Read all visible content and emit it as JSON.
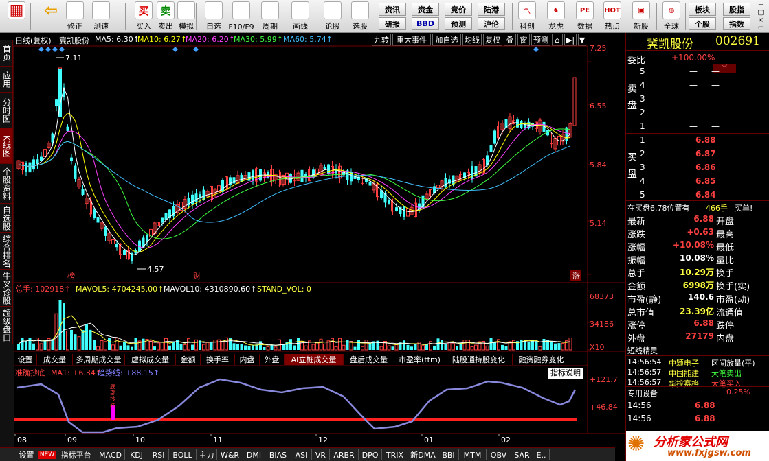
{
  "toolbar": {
    "left_items": [
      {
        "label": "",
        "icon": "grid-icon"
      },
      {
        "label": "",
        "icon": "back-arrow-icon"
      },
      {
        "label": "修正",
        "icon": "up-arrow-icon"
      },
      {
        "label": "测速",
        "icon": "clock-icon"
      },
      {
        "label": "买入",
        "icon": "buy-icon",
        "glyph": "买"
      },
      {
        "label": "卖出",
        "icon": "sell-icon",
        "glyph": "卖"
      },
      {
        "label": "模拟",
        "icon": "hammer-icon"
      },
      {
        "label": "自选",
        "icon": "star-icon"
      },
      {
        "label": "F10/F9",
        "icon": "f10-icon"
      },
      {
        "label": "周期",
        "icon": "period-icon"
      },
      {
        "label": "画线",
        "icon": "pencil-icon"
      },
      {
        "label": "论股",
        "icon": "discuss-icon",
        "glyph": "论"
      },
      {
        "label": "选股",
        "icon": "select-stock-icon"
      }
    ],
    "grid_buttons": [
      [
        "资讯",
        "资金",
        "竞价",
        "陆港"
      ],
      [
        "研报",
        "BBD",
        "预测",
        "沪伦"
      ]
    ],
    "right_items": [
      {
        "label": "科创",
        "icon": "kechuang-icon"
      },
      {
        "label": "龙虎",
        "icon": "dragon-tiger-icon"
      },
      {
        "label": "数据",
        "icon": "data-icon",
        "glyph": "PE"
      },
      {
        "label": "热点",
        "icon": "hot-icon",
        "glyph": "HOT"
      },
      {
        "label": "新股",
        "icon": "new-stock-icon"
      },
      {
        "label": "全球",
        "icon": "globe-icon"
      }
    ],
    "right_buttons": [
      [
        "板块",
        "股指"
      ],
      [
        "个股",
        "指数"
      ]
    ],
    "window_controls": [
      "−",
      "▢",
      "×",
      "⌐"
    ]
  },
  "sidetabs": [
    "首页",
    "应用",
    "分时图",
    "K线图",
    "个股资料",
    "自选股",
    "综合排名",
    "牛叉诊股",
    "超级盘口"
  ],
  "main_header": {
    "left": "日线(复权)",
    "stock": "冀凯股份",
    "ma": [
      {
        "label": "MA5: 6.30↑",
        "color": "#ffffff"
      },
      {
        "label": "MA10: 6.27↑",
        "color": "#ffff00"
      },
      {
        "label": "MA20: 6.20↑",
        "color": "#ff40ff"
      },
      {
        "label": "MA30: 5.99↑",
        "color": "#40ff40"
      },
      {
        "label": "MA60: 5.74↑",
        "color": "#40c0ff"
      }
    ],
    "tools": [
      "九转",
      "重大事件",
      "加自选",
      "均线",
      "复权",
      "叠",
      "窗",
      "预测",
      "⌂",
      "▶|",
      "▼"
    ]
  },
  "price_axis": [
    "7.25",
    "6.55",
    "5.84",
    "5.14"
  ],
  "annotations": {
    "high": "7.11",
    "low": "4.57",
    "marker_bang": "榜",
    "marker_cai": "财",
    "marker_zhang": "涨"
  },
  "volume": {
    "header": [
      {
        "label": "总手: 102918↑",
        "color": "#ff4040"
      },
      {
        "label": "MAVOL5: 4704245.00↑",
        "color": "#ffff40"
      },
      {
        "label": "MAVOL10: 4310890.60↑",
        "color": "#ffffff"
      },
      {
        "label": "STAND_VOL: 0",
        "color": "#ffff40"
      }
    ],
    "axis": [
      "68373",
      "34186",
      "X10"
    ]
  },
  "bottom_tabs": [
    "设置",
    "成交量",
    "多周期成交量",
    "虚拟成交量",
    "金额",
    "换手率",
    "内盘",
    "外盘",
    "AI立桩成交量",
    "盘后成交量",
    "市盈率(ttm)",
    "陆股通持股变化",
    "融资融券变化"
  ],
  "indicator": {
    "name": "准确抄底",
    "ma1": "MA1: +6.34↑",
    "trend": "趋势线: +88.15↑",
    "explain": "指标说明",
    "axis": [
      "+121.7",
      "+46.84"
    ],
    "signal": "底部抄底"
  },
  "date_axis": [
    "08",
    "09",
    "10",
    "11",
    "12",
    "01",
    "02"
  ],
  "bottom_bar": [
    "设置",
    "NEW",
    "指标平台",
    "MACD",
    "KDJ",
    "RSI",
    "BOLL",
    "主力",
    "W&R",
    "DMI",
    "BIAS",
    "ASI",
    "VR",
    "ARBR",
    "DPO",
    "TRIX",
    "新DMA",
    "BBI",
    "MTM",
    "OBV",
    "SAR",
    "E.."
  ],
  "quote": {
    "name": "冀凯股份",
    "code": "002691",
    "weibi_label": "委比",
    "weibi": "+100.00%",
    "sell_label": "卖盘",
    "buy_label": "买盘",
    "sell": [
      {
        "lvl": "5",
        "p": "—"
      },
      {
        "lvl": "4",
        "p": "—"
      },
      {
        "lvl": "3",
        "p": "—"
      },
      {
        "lvl": "2",
        "p": "—"
      },
      {
        "lvl": "1",
        "p": "—"
      }
    ],
    "buy": [
      {
        "lvl": "1",
        "p": "6.88"
      },
      {
        "lvl": "2",
        "p": "6.87"
      },
      {
        "lvl": "3",
        "p": "6.86"
      },
      {
        "lvl": "4",
        "p": "6.85"
      },
      {
        "lvl": "5",
        "p": "6.84"
      }
    ],
    "notice_left": "在买盘6.78位置有",
    "notice_qty": "466手",
    "notice_right": "买单!",
    "stats": [
      {
        "l": "最新",
        "v": "6.88",
        "c": "#ff4040",
        "l2": "开盘",
        "v2": ""
      },
      {
        "l": "涨跌",
        "v": "+0.63",
        "c": "#ff4040",
        "l2": "最高",
        "v2": ""
      },
      {
        "l": "涨幅",
        "v": "+10.08%",
        "c": "#ff4040",
        "l2": "最低",
        "v2": ""
      },
      {
        "l": "振幅",
        "v": "10.08%",
        "c": "#ffffff",
        "l2": "量比",
        "v2": ""
      },
      {
        "l": "总手",
        "v": "10.29万",
        "c": "#ffff40",
        "l2": "换手",
        "v2": ""
      },
      {
        "l": "金额",
        "v": "6998万",
        "c": "#ffff40",
        "l2": "换手(实)",
        "v2": ""
      },
      {
        "l": "市盈(静)",
        "v": "140.6",
        "c": "#ffffff",
        "l2": "市盈(动)",
        "v2": ""
      },
      {
        "l": "总市值",
        "v": "23.39亿",
        "c": "#ffff40",
        "l2": "流通值",
        "v2": ""
      },
      {
        "l": "涨停",
        "v": "6.88",
        "c": "#ff4040",
        "l2": "跌停",
        "v2": ""
      },
      {
        "l": "外盘",
        "v": "27179",
        "c": "#ff4040",
        "l2": "内盘",
        "v2": ""
      }
    ],
    "short_title": "短线精灵",
    "short": [
      {
        "t": "14:56:54",
        "n": "中颖电子",
        "e": "区间放量(平)",
        "ec": "#ffffff"
      },
      {
        "t": "14:56:57",
        "n": "中国能建",
        "e": "大笔卖出",
        "ec": "#40ff40"
      },
      {
        "t": "14:56:57",
        "n": "华控赛格",
        "e": "大笔买入",
        "ec": "#ff4040"
      }
    ],
    "device_label": "专用设备",
    "device_pct": "0.25%",
    "ticks": [
      {
        "t": "14:56",
        "p": "6.88"
      },
      {
        "t": "14:56",
        "p": "6.88"
      }
    ],
    "watermark": "分析家公式网",
    "watermark_url": "www.fxjgsw.com"
  },
  "colors": {
    "up": "#ff4040",
    "down": "#40ffff",
    "bg": "#000000",
    "grid": "#600000"
  }
}
